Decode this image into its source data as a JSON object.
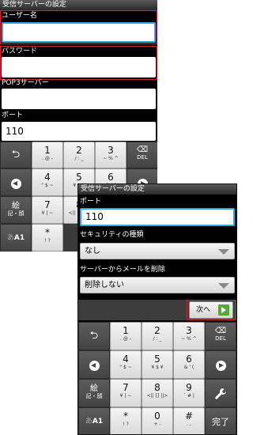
{
  "screen1": {
    "title": "受信サーバーの設定",
    "username_label": "ユーザー名",
    "username_value": "",
    "password_label": "パスワード",
    "password_value": "",
    "pop3_label": "POP3サーバー",
    "pop3_value": "",
    "port_label": "ポート",
    "port_value": "110"
  },
  "screen2": {
    "title": "受信サーバーの設定",
    "port_label": "ポート",
    "port_value": "110",
    "security_label": "セキュリティの種類",
    "security_value": "なし",
    "delete_label": "サーバーからメールを削除",
    "delete_value": "削除しない",
    "next_label": "次へ"
  },
  "keyboard": {
    "back": "⮌",
    "del_glyph": "⌫",
    "del_label": "DEL",
    "kana_label": "絵\n記・顔",
    "kana_line1": "絵",
    "kana_line2": "記・顔",
    "mode_label_a": "あ",
    "mode_label_b": "A1",
    "done": "完了",
    "keys": [
      {
        "main": "1",
        "sub": ". @ -"
      },
      {
        "main": "2",
        "sub": "/ : _"
      },
      {
        "main": "3",
        "sub": "~ % ^"
      },
      {
        "main": "4",
        "sub": "\" $ ~"
      },
      {
        "main": "5",
        "sub": "¥ $ ¥"
      },
      {
        "main": "6",
        "sub": "& ' ("
      },
      {
        "main": "7",
        "sub": "¥ | ~"
      },
      {
        "main": "8",
        "sub": "<|| [] ||>"
      },
      {
        "main": "9",
        "sub": "` # |"
      },
      {
        "main": "*",
        "sub": "! ?"
      },
      {
        "main": "0",
        "sub": "+ -"
      },
      {
        "main": "#",
        "sub": ". ,"
      }
    ]
  }
}
